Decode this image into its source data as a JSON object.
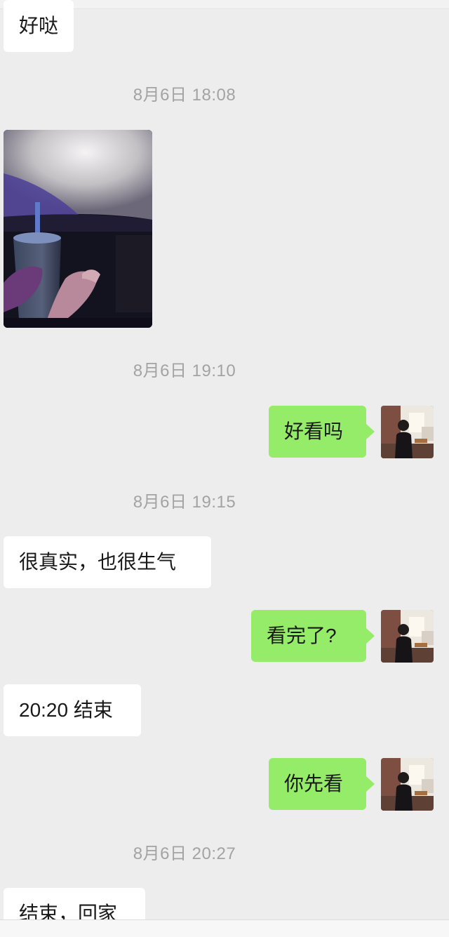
{
  "messages": [
    {
      "side": "left",
      "text": "好哒"
    },
    {
      "timestamp": "8月6日 18:08"
    },
    {
      "side": "left",
      "type": "image",
      "image_alt": "cinema-photo"
    },
    {
      "timestamp": "8月6日 19:10"
    },
    {
      "side": "right",
      "text": "好看吗"
    },
    {
      "timestamp": "8月6日 19:15"
    },
    {
      "side": "left",
      "text": "很真实，也很生气"
    },
    {
      "side": "right",
      "text": "看完了?"
    },
    {
      "side": "left",
      "text": "20:20 结束"
    },
    {
      "side": "right",
      "text": "你先看"
    },
    {
      "timestamp": "8月6日 20:27"
    },
    {
      "side": "left",
      "text": "结束，回家"
    }
  ],
  "colors": {
    "background": "#ededed",
    "bubble_incoming": "#ffffff",
    "bubble_outgoing": "#95ec69",
    "timestamp_text": "#a3a3a3",
    "message_text": "#191919"
  }
}
